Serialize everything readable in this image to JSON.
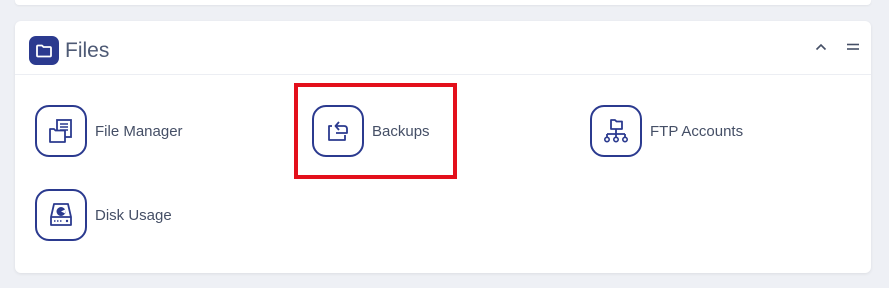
{
  "panel": {
    "title": "Files",
    "icon": "folder-icon",
    "collapse_icon": "chevron-up-icon",
    "menu_icon": "menu-icon"
  },
  "tools": [
    {
      "label": "File Manager",
      "icon": "file-manager-icon"
    },
    {
      "label": "Backups",
      "icon": "backup-icon"
    },
    {
      "label": "FTP Accounts",
      "icon": "ftp-network-icon"
    },
    {
      "label": "Disk Usage",
      "icon": "disk-icon"
    }
  ],
  "colors": {
    "accent": "#2b3a8f",
    "highlight": "#e3101b",
    "label_text": "#454f66"
  }
}
